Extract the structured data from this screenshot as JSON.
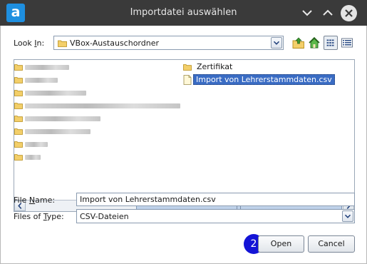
{
  "window": {
    "title": "Importdatei auswählen",
    "app_icon_letter": "a"
  },
  "look_in": {
    "label_prefix": "Look ",
    "label_mnemonic": "I",
    "label_suffix": "n:",
    "value": "VBox-Austauschordner"
  },
  "file_list": {
    "blurred_folder_count": 8,
    "folders": [
      {
        "name": "Zertifikat"
      }
    ],
    "files": [
      {
        "name": "Import von Lehrerstammdaten.csv",
        "selected": true
      }
    ]
  },
  "file_name": {
    "label_prefix": "File ",
    "label_mnemonic": "N",
    "label_suffix": "ame:",
    "value": "Import von Lehrerstammdaten.csv"
  },
  "files_of_type": {
    "label_prefix": "Files of ",
    "label_mnemonic": "T",
    "label_suffix": "ype:",
    "value": "CSV-Dateien"
  },
  "buttons": {
    "open": "Open",
    "cancel": "Cancel"
  },
  "annotation": {
    "step_number": "2",
    "color": "#1414d6"
  },
  "colors": {
    "titlebar": "#3a3a3a",
    "selection": "#3a6cc4",
    "app_icon": "#1e8fe0"
  }
}
